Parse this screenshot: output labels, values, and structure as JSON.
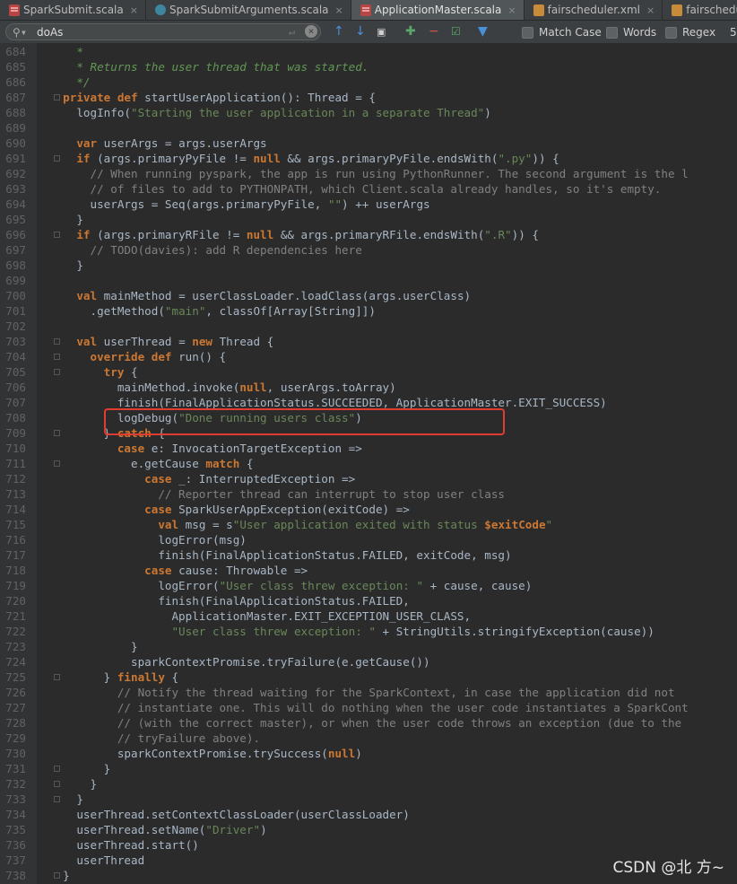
{
  "tabs": [
    {
      "label": "SparkSubmit.scala",
      "icon": "scala-file-icon",
      "active": false
    },
    {
      "label": "SparkSubmitArguments.scala",
      "icon": "scala-class-icon",
      "active": false
    },
    {
      "label": "ApplicationMaster.scala",
      "icon": "scala-file-icon",
      "active": true
    },
    {
      "label": "fairscheduler.xml",
      "icon": "xml-file-icon",
      "active": false
    },
    {
      "label": "fairscheduler-with-va",
      "icon": "xml-file-icon",
      "active": false
    }
  ],
  "find": {
    "query": "doAs",
    "match_case_label": "Match Case",
    "words_label": "Words",
    "regex_label": "Regex",
    "overflow_label": "5"
  },
  "watermark": "CSDN @北 方~",
  "colors": {
    "keyword": "#cc7832",
    "string": "#6a8759",
    "comment": "#808080",
    "doc_comment": "#629755",
    "text": "#a9b7c6",
    "highlight_box": "#e03c32"
  },
  "code_lines": [
    {
      "num": "684",
      "segments": [
        [
          "c",
          "    "
        ],
        [
          "ci",
          "*"
        ]
      ]
    },
    {
      "num": "685",
      "segments": [
        [
          "ci",
          "    * Returns the user thread that was started."
        ]
      ]
    },
    {
      "num": "686",
      "segments": [
        [
          "ci",
          "    */"
        ]
      ]
    },
    {
      "num": "687",
      "segments": [
        [
          "k",
          "  private def "
        ],
        [
          "t",
          "startUserApplication(): Thread = {"
        ]
      ]
    },
    {
      "num": "688",
      "segments": [
        [
          "t",
          "    logInfo("
        ],
        [
          "s",
          "\"Starting the user application in a separate Thread\""
        ],
        [
          "t",
          ")"
        ]
      ]
    },
    {
      "num": "689",
      "segments": []
    },
    {
      "num": "690",
      "segments": [
        [
          "k",
          "    var "
        ],
        [
          "t",
          "userArgs = args.userArgs"
        ]
      ]
    },
    {
      "num": "691",
      "segments": [
        [
          "k",
          "    if "
        ],
        [
          "t",
          "(args.primaryPyFile != "
        ],
        [
          "k",
          "null "
        ],
        [
          "t",
          "&& args.primaryPyFile.endsWith("
        ],
        [
          "s",
          "\".py\""
        ],
        [
          "t",
          ")) {"
        ]
      ]
    },
    {
      "num": "692",
      "segments": [
        [
          "c",
          "      // When running pyspark, the app is run using PythonRunner. The second argument is the l"
        ]
      ]
    },
    {
      "num": "693",
      "segments": [
        [
          "c",
          "      // of files to add to PYTHONPATH, which Client.scala already handles, so it's empty."
        ]
      ]
    },
    {
      "num": "694",
      "segments": [
        [
          "t",
          "      userArgs = Seq(args.primaryPyFile, "
        ],
        [
          "s",
          "\"\""
        ],
        [
          "t",
          ") ++ userArgs"
        ]
      ]
    },
    {
      "num": "695",
      "segments": [
        [
          "t",
          "    }"
        ]
      ]
    },
    {
      "num": "696",
      "segments": [
        [
          "k",
          "    if "
        ],
        [
          "t",
          "(args.primaryRFile != "
        ],
        [
          "k",
          "null "
        ],
        [
          "t",
          "&& args.primaryRFile.endsWith("
        ],
        [
          "s",
          "\".R\""
        ],
        [
          "t",
          ")) {"
        ]
      ]
    },
    {
      "num": "697",
      "segments": [
        [
          "c",
          "      // TODO(davies): add R dependencies here"
        ]
      ]
    },
    {
      "num": "698",
      "segments": [
        [
          "t",
          "    }"
        ]
      ]
    },
    {
      "num": "699",
      "segments": []
    },
    {
      "num": "700",
      "segments": [
        [
          "k",
          "    val "
        ],
        [
          "t",
          "mainMethod = userClassLoader.loadClass(args.userClass)"
        ]
      ]
    },
    {
      "num": "701",
      "segments": [
        [
          "t",
          "      .getMethod("
        ],
        [
          "s",
          "\"main\""
        ],
        [
          "t",
          ", classOf[Array[String]])"
        ]
      ]
    },
    {
      "num": "702",
      "segments": []
    },
    {
      "num": "703",
      "segments": [
        [
          "k",
          "    val "
        ],
        [
          "t",
          "userThread = "
        ],
        [
          "k",
          "new "
        ],
        [
          "t",
          "Thread {"
        ]
      ]
    },
    {
      "num": "704",
      "segments": [
        [
          "k",
          "      override def "
        ],
        [
          "t",
          "run() {"
        ]
      ]
    },
    {
      "num": "705",
      "segments": [
        [
          "k",
          "        try "
        ],
        [
          "t",
          "{"
        ]
      ]
    },
    {
      "num": "706",
      "segments": [
        [
          "t",
          "          mainMethod.invoke("
        ],
        [
          "k",
          "null"
        ],
        [
          "t",
          ", userArgs.toArray)"
        ]
      ]
    },
    {
      "num": "707",
      "segments": [
        [
          "t",
          "          finish(FinalApplicationStatus.SUCCEEDED, ApplicationMaster.EXIT_SUCCESS)"
        ]
      ]
    },
    {
      "num": "708",
      "segments": [
        [
          "t",
          "          logDebug("
        ],
        [
          "s",
          "\"Done running users class\""
        ],
        [
          "t",
          ")"
        ]
      ]
    },
    {
      "num": "709",
      "segments": [
        [
          "t",
          "        } "
        ],
        [
          "k",
          "catch "
        ],
        [
          "t",
          "{"
        ]
      ]
    },
    {
      "num": "710",
      "segments": [
        [
          "k",
          "          case "
        ],
        [
          "t",
          "e: InvocationTargetException =>"
        ]
      ]
    },
    {
      "num": "711",
      "segments": [
        [
          "t",
          "            e.getCause "
        ],
        [
          "k",
          "match "
        ],
        [
          "t",
          "{"
        ]
      ]
    },
    {
      "num": "712",
      "segments": [
        [
          "k",
          "              case "
        ],
        [
          "t",
          "_: InterruptedException =>"
        ]
      ]
    },
    {
      "num": "713",
      "segments": [
        [
          "c",
          "                // Reporter thread can interrupt to stop user class"
        ]
      ]
    },
    {
      "num": "714",
      "segments": [
        [
          "k",
          "              case "
        ],
        [
          "t",
          "SparkUserAppException(exitCode) =>"
        ]
      ]
    },
    {
      "num": "715",
      "segments": [
        [
          "k",
          "                val "
        ],
        [
          "t",
          "msg = s"
        ],
        [
          "s",
          "\"User application exited with status "
        ],
        [
          "tv",
          "$exitCode"
        ],
        [
          "s",
          "\""
        ]
      ]
    },
    {
      "num": "716",
      "segments": [
        [
          "t",
          "                logError(msg)"
        ]
      ]
    },
    {
      "num": "717",
      "segments": [
        [
          "t",
          "                finish(FinalApplicationStatus.FAILED, exitCode, msg)"
        ]
      ]
    },
    {
      "num": "718",
      "segments": [
        [
          "k",
          "              case "
        ],
        [
          "t",
          "cause: Throwable =>"
        ]
      ]
    },
    {
      "num": "719",
      "segments": [
        [
          "t",
          "                logError("
        ],
        [
          "s",
          "\"User class threw exception: \""
        ],
        [
          "t",
          " + cause, cause)"
        ]
      ]
    },
    {
      "num": "720",
      "segments": [
        [
          "t",
          "                finish(FinalApplicationStatus.FAILED,"
        ]
      ]
    },
    {
      "num": "721",
      "segments": [
        [
          "t",
          "                  ApplicationMaster.EXIT_EXCEPTION_USER_CLASS,"
        ]
      ]
    },
    {
      "num": "722",
      "segments": [
        [
          "s",
          "                  \"User class threw exception: \""
        ],
        [
          "t",
          " + StringUtils.stringifyException(cause))"
        ]
      ]
    },
    {
      "num": "723",
      "segments": [
        [
          "t",
          "            }"
        ]
      ]
    },
    {
      "num": "724",
      "segments": [
        [
          "t",
          "            sparkContextPromise.tryFailure(e.getCause())"
        ]
      ]
    },
    {
      "num": "725",
      "segments": [
        [
          "t",
          "        } "
        ],
        [
          "k",
          "finally "
        ],
        [
          "t",
          "{"
        ]
      ]
    },
    {
      "num": "726",
      "segments": [
        [
          "c",
          "          // Notify the thread waiting for the SparkContext, in case the application did not"
        ]
      ]
    },
    {
      "num": "727",
      "segments": [
        [
          "c",
          "          // instantiate one. This will do nothing when the user code instantiates a SparkCont"
        ]
      ]
    },
    {
      "num": "728",
      "segments": [
        [
          "c",
          "          // (with the correct master), or when the user code throws an exception (due to the"
        ]
      ]
    },
    {
      "num": "729",
      "segments": [
        [
          "c",
          "          // tryFailure above)."
        ]
      ]
    },
    {
      "num": "730",
      "segments": [
        [
          "t",
          "          sparkContextPromise.trySuccess("
        ],
        [
          "k",
          "null"
        ],
        [
          "t",
          ")"
        ]
      ]
    },
    {
      "num": "731",
      "segments": [
        [
          "t",
          "        }"
        ]
      ]
    },
    {
      "num": "732",
      "segments": [
        [
          "t",
          "      }"
        ]
      ]
    },
    {
      "num": "733",
      "segments": [
        [
          "t",
          "    }"
        ]
      ]
    },
    {
      "num": "734",
      "segments": [
        [
          "t",
          "    userThread.setContextClassLoader(userClassLoader)"
        ]
      ]
    },
    {
      "num": "735",
      "segments": [
        [
          "t",
          "    userThread.setName("
        ],
        [
          "s",
          "\"Driver\""
        ],
        [
          "t",
          ")"
        ]
      ]
    },
    {
      "num": "736",
      "segments": [
        [
          "t",
          "    userThread.start()"
        ]
      ]
    },
    {
      "num": "737",
      "segments": [
        [
          "t",
          "    userThread"
        ]
      ]
    },
    {
      "num": "738",
      "segments": [
        [
          "t",
          "  }"
        ]
      ]
    }
  ]
}
